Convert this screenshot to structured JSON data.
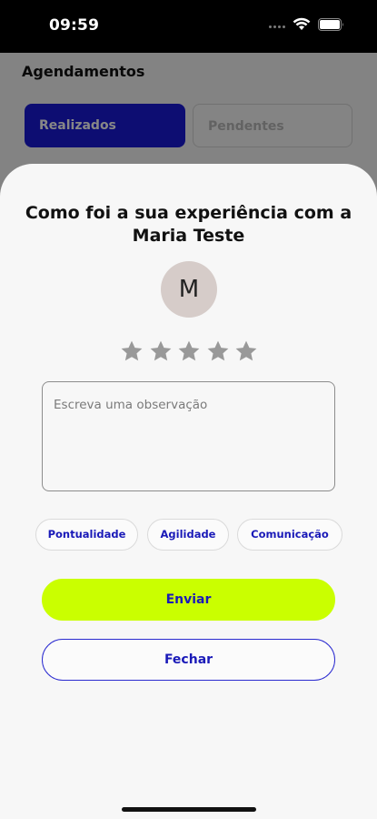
{
  "status_bar": {
    "time": "09:59"
  },
  "background": {
    "title": "Agendamentos",
    "tabs": [
      {
        "label": "Realizados",
        "active": true
      },
      {
        "label": "Pendentes",
        "active": false
      }
    ]
  },
  "modal": {
    "title": "Como foi a sua experiência com a Maria Teste",
    "avatar_initial": "M",
    "rating": {
      "max": 5,
      "selected": 0,
      "star_color": "#999999"
    },
    "observation": {
      "placeholder": "Escreva uma observação",
      "value": ""
    },
    "tags": [
      "Pontualidade",
      "Agilidade",
      "Comunicação"
    ],
    "buttons": {
      "submit": "Enviar",
      "close": "Fechar"
    }
  },
  "colors": {
    "accent_blue": "#1a1ad8",
    "accent_lime": "#caff00",
    "avatar_bg": "#d6ccc9"
  }
}
